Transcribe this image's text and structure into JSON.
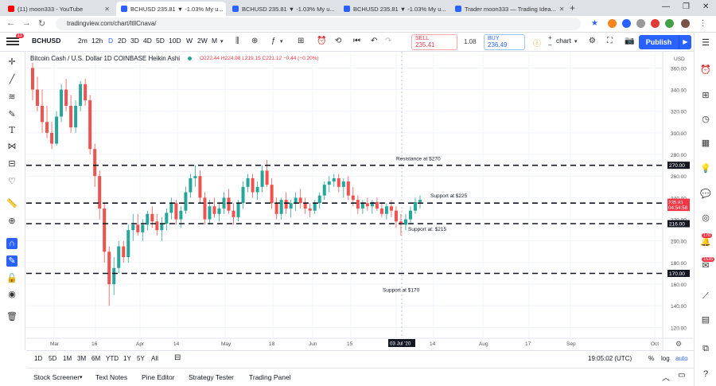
{
  "browser": {
    "tabs": [
      {
        "title": "(11) moon333 - YouTube",
        "color": "#ff0000"
      },
      {
        "title": "BCHUSD 235.81 ▼ -1.03% My u...",
        "color": "#2962ff"
      },
      {
        "title": "BCHUSD 235.81 ▼ -1.03% My u...",
        "color": "#2962ff"
      },
      {
        "title": "BCHUSD 235.81 ▼ -1.03% My u...",
        "color": "#2962ff"
      },
      {
        "title": "Trader moon333 — Trading Idea...",
        "color": "#2962ff"
      }
    ],
    "url": "tradingview.com/chart/ltllCnava/"
  },
  "toolbar": {
    "symbol": "BCHUSD",
    "notifications": "11",
    "intervals": [
      "2m",
      "12h",
      "D",
      "2D",
      "3D",
      "4D",
      "5D",
      "10D",
      "W",
      "2W",
      "M"
    ],
    "active_interval": "D",
    "sell_label": "SELL",
    "sell_price": "235.41",
    "spread": "1.08",
    "buy_label": "BUY",
    "buy_price": "236.49",
    "layout_label": "chart",
    "publish_label": "Publish"
  },
  "legend": {
    "title": "Bitcoin Cash / U.S. Dollar  1D  COINBASE  Heikin Ashi",
    "values": "O222.44  H224.98  L219.15  C221.12  −0.44 (−0.20%)"
  },
  "chart_data": {
    "type": "candlestick",
    "style": "Heikin Ashi",
    "y_currency": "USD",
    "ylim": [
      110,
      375
    ],
    "y_ticks": [
      "360.00",
      "340.00",
      "320.00",
      "300.00",
      "280.00",
      "260.00",
      "240.00",
      "220.00",
      "200.00",
      "180.00",
      "160.00",
      "140.00",
      "120.00"
    ],
    "x_ticks": [
      "Mar",
      "16",
      "Apr",
      "14",
      "May",
      "18",
      "Jun",
      "15",
      "Jul",
      "14",
      "Aug",
      "17",
      "Sep",
      "Oct"
    ],
    "highlighted_date": "03 Jul '20",
    "horizontal_lines": [
      {
        "price": 270,
        "label": "Resistance at $270",
        "axis_label": "270.00"
      },
      {
        "price": 235,
        "label": "Support at $225",
        "axis_label": "235.81"
      },
      {
        "price": 216,
        "label": "Support at: $215",
        "axis_label": "216.00"
      },
      {
        "price": 170,
        "label": "Support at $170",
        "axis_label": "170.00"
      }
    ],
    "price_tags": [
      {
        "price": 235.81,
        "text": "235.81",
        "color": "#f23645"
      },
      {
        "price": 231,
        "text": "04:54:58",
        "color": "#f23645"
      }
    ],
    "candles": [
      [
        360,
        365,
        330,
        340
      ],
      [
        340,
        352,
        320,
        325
      ],
      [
        325,
        340,
        300,
        310
      ],
      [
        310,
        325,
        295,
        300
      ],
      [
        300,
        310,
        285,
        290
      ],
      [
        290,
        320,
        288,
        315
      ],
      [
        315,
        345,
        310,
        340
      ],
      [
        340,
        350,
        320,
        325
      ],
      [
        325,
        335,
        300,
        305
      ],
      [
        305,
        330,
        300,
        325
      ],
      [
        325,
        348,
        320,
        345
      ],
      [
        345,
        350,
        325,
        330
      ],
      [
        330,
        335,
        280,
        285
      ],
      [
        285,
        290,
        250,
        260
      ],
      [
        260,
        265,
        220,
        230
      ],
      [
        230,
        235,
        180,
        190
      ],
      [
        190,
        195,
        140,
        160
      ],
      [
        160,
        185,
        150,
        175
      ],
      [
        175,
        200,
        170,
        195
      ],
      [
        195,
        200,
        180,
        185
      ],
      [
        185,
        215,
        180,
        210
      ],
      [
        210,
        225,
        200,
        215
      ],
      [
        215,
        225,
        205,
        208
      ],
      [
        208,
        220,
        200,
        215
      ],
      [
        215,
        228,
        210,
        225
      ],
      [
        225,
        232,
        212,
        218
      ],
      [
        218,
        225,
        205,
        210
      ],
      [
        210,
        222,
        200,
        216
      ],
      [
        216,
        230,
        210,
        226
      ],
      [
        226,
        240,
        220,
        235
      ],
      [
        235,
        238,
        215,
        220
      ],
      [
        220,
        232,
        212,
        228
      ],
      [
        228,
        250,
        225,
        245
      ],
      [
        245,
        262,
        240,
        258
      ],
      [
        258,
        270,
        250,
        260
      ],
      [
        260,
        265,
        235,
        240
      ],
      [
        240,
        245,
        215,
        220
      ],
      [
        220,
        238,
        215,
        232
      ],
      [
        232,
        240,
        222,
        225
      ],
      [
        225,
        235,
        218,
        230
      ],
      [
        230,
        245,
        225,
        240
      ],
      [
        240,
        248,
        225,
        228
      ],
      [
        228,
        235,
        215,
        222
      ],
      [
        222,
        238,
        218,
        235
      ],
      [
        235,
        255,
        230,
        250
      ],
      [
        250,
        262,
        245,
        258
      ],
      [
        258,
        262,
        240,
        245
      ],
      [
        245,
        255,
        238,
        250
      ],
      [
        250,
        270,
        245,
        265
      ],
      [
        265,
        275,
        250,
        252
      ],
      [
        252,
        258,
        230,
        235
      ],
      [
        235,
        240,
        220,
        225
      ],
      [
        225,
        240,
        220,
        238
      ],
      [
        238,
        245,
        225,
        230
      ],
      [
        230,
        238,
        222,
        235
      ],
      [
        235,
        245,
        228,
        240
      ],
      [
        240,
        248,
        230,
        235
      ],
      [
        235,
        240,
        225,
        230
      ],
      [
        230,
        235,
        222,
        228
      ],
      [
        228,
        238,
        225,
        235
      ],
      [
        235,
        245,
        230,
        242
      ],
      [
        242,
        255,
        238,
        252
      ],
      [
        252,
        260,
        245,
        255
      ],
      [
        255,
        262,
        250,
        258
      ],
      [
        258,
        262,
        245,
        250
      ],
      [
        250,
        258,
        240,
        255
      ],
      [
        255,
        260,
        238,
        242
      ],
      [
        242,
        250,
        232,
        238
      ],
      [
        238,
        242,
        225,
        230
      ],
      [
        230,
        238,
        225,
        235
      ],
      [
        235,
        240,
        228,
        232
      ],
      [
        232,
        238,
        225,
        236
      ],
      [
        236,
        240,
        228,
        230
      ],
      [
        230,
        236,
        222,
        225
      ],
      [
        225,
        235,
        220,
        232
      ],
      [
        232,
        238,
        222,
        228
      ],
      [
        228,
        232,
        212,
        218
      ],
      [
        218,
        225,
        205,
        215
      ],
      [
        215,
        225,
        210,
        220
      ],
      [
        220,
        232,
        215,
        228
      ],
      [
        228,
        240,
        225,
        236
      ],
      [
        236,
        242,
        230,
        238
      ]
    ]
  },
  "range_bar": {
    "ranges": [
      "1D",
      "5D",
      "1M",
      "3M",
      "6M",
      "YTD",
      "1Y",
      "5Y",
      "All"
    ],
    "time": "19:05:02 (UTC)",
    "pct_label": "%",
    "log_label": "log",
    "auto_label": "auto"
  },
  "bottom_bar": {
    "tabs": [
      "Stock Screener",
      "Text Notes",
      "Pine Editor",
      "Strategy Tester",
      "Trading Panel"
    ]
  },
  "colors": {
    "up": "#26a69a",
    "down": "#ef5350",
    "accent": "#2962ff"
  }
}
